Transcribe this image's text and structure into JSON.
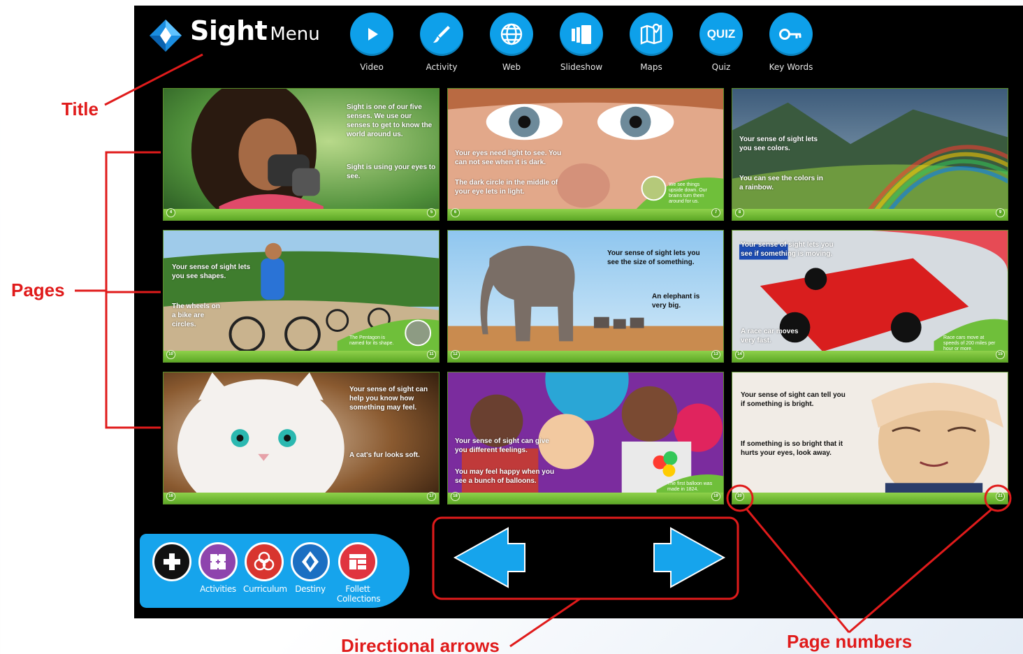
{
  "header": {
    "title_main": "Sight",
    "title_sub": "Menu"
  },
  "toolbar": [
    {
      "label": "Video",
      "icon": "play-icon"
    },
    {
      "label": "Activity",
      "icon": "brush-icon"
    },
    {
      "label": "Web",
      "icon": "globe-icon"
    },
    {
      "label": "Slideshow",
      "icon": "slideshow-icon"
    },
    {
      "label": "Maps",
      "icon": "map-icon"
    },
    {
      "label": "Quiz",
      "icon": "quiz-icon",
      "badge": "QUIZ"
    },
    {
      "label": "Key Words",
      "icon": "key-icon"
    }
  ],
  "pages": [
    {
      "texts": [
        "Sight is one of our five senses. We use our senses to get to know the world around us.",
        "Sight is using your eyes to see."
      ],
      "left_num": "4",
      "right_num": "5"
    },
    {
      "texts": [
        "Your eyes need light to see. You can not see when it is dark.",
        "The dark circle in the middle of your eye lets in light."
      ],
      "side_note": "We see things upside down. Our brains turn them around for us.",
      "left_num": "6",
      "right_num": "7"
    },
    {
      "texts": [
        "Your sense of sight lets you see colors.",
        "You can see the colors in a rainbow."
      ],
      "left_num": "8",
      "right_num": "9"
    },
    {
      "texts": [
        "Your sense of sight lets you see shapes.",
        "The wheels on a bike are circles."
      ],
      "side_note": "The Pentagon is named for its shape.",
      "left_num": "10",
      "right_num": "11"
    },
    {
      "texts": [
        "Your sense of sight lets you see the size of something.",
        "An elephant is very big."
      ],
      "left_num": "12",
      "right_num": "13"
    },
    {
      "texts": [
        "Your sense of sight lets you see if something is moving.",
        "A race car moves very fast."
      ],
      "side_note": "Race cars move at speeds of 200 miles per hour or more.",
      "left_num": "14",
      "right_num": "15"
    },
    {
      "texts": [
        "Your sense of sight can help you know how something may feel.",
        "A cat's fur looks soft."
      ],
      "left_num": "16",
      "right_num": "17"
    },
    {
      "texts": [
        "Your sense of sight can give you different feelings.",
        "You may feel happy when you see a bunch of balloons."
      ],
      "side_note": "The first balloon was made in 1824.",
      "left_num": "18",
      "right_num": "19"
    },
    {
      "texts": [
        "Your sense of sight can tell you if something is bright.",
        "If something is so bright that it hurts your eyes, look away."
      ],
      "left_num": "20",
      "right_num": "21"
    }
  ],
  "quick_links": [
    {
      "label": "",
      "icon": "plus-icon"
    },
    {
      "label": "Activities",
      "icon": "puzzle-icon"
    },
    {
      "label": "Curriculum",
      "icon": "curriculum-icon"
    },
    {
      "label": "Destiny",
      "icon": "destiny-icon"
    },
    {
      "label": "Follett Collections",
      "icon": "collections-icon"
    }
  ],
  "annotations": {
    "title": "Title",
    "pages": "Pages",
    "arrows": "Directional arrows",
    "page_numbers": "Page numbers"
  },
  "colors": {
    "accent": "#0ea0ea",
    "annotation": "#e01b1b",
    "page_strip": "#5da826"
  }
}
